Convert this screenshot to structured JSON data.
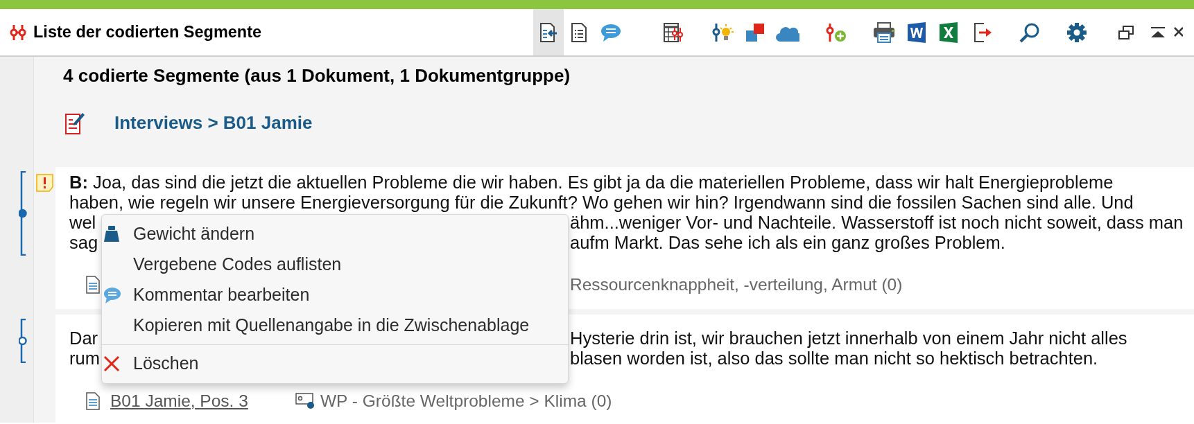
{
  "window": {
    "title": "Liste der codierten Segmente"
  },
  "toolbar": [
    {
      "selected": true
    },
    {
      "selected": false
    },
    {
      "selected": false
    },
    {
      "selected": false
    },
    {
      "selected": false
    },
    {
      "selected": false
    },
    {
      "selected": false
    },
    {
      "selected": false
    },
    {
      "selected": false
    },
    {
      "selected": false
    },
    {
      "selected": false
    },
    {
      "selected": false
    },
    {
      "selected": false
    },
    {
      "selected": false
    },
    {
      "selected": false
    },
    {
      "selected": false
    },
    {
      "selected": false
    }
  ],
  "summary": "4 codierte Segmente (aus 1 Dokument, 1 Dokumentgruppe)",
  "document_path": "Interviews > B01 Jamie",
  "segments": [
    {
      "marker_filled": true,
      "has_comment": true,
      "lines": [
        {
          "text": "**B:** Joa, das sind die jetzt die aktuellen Probleme die wir haben. Es gibt ja da die materiellen Probleme, dass wir halt Energieprobleme"
        },
        {
          "text": "haben, wie regeln wir unsere Energieversorgung für die Zukunft? Wo gehen wir hin? Irgendwann sind die fossilen Sachen sind alle. Und"
        },
        {
          "left": "wel",
          "right": "ähm...weniger Vor- und Nachteile. Wasserstoff ist noch nicht soweit, dass man"
        },
        {
          "left": "sag",
          "right": "aufm Markt. Das sehe ich als ein ganz großes Problem."
        }
      ],
      "code": "Ressourcenknappheit, -verteilung, Armut (0)"
    },
    {
      "marker_filled": false,
      "has_comment": false,
      "lines": [
        {
          "left": "Dar",
          "right": "Hysterie drin ist, wir brauchen jetzt innerhalb von einem Jahr nicht alles"
        },
        {
          "left": "rum",
          "right": "blasen worden ist, also das sollte man nicht so hektisch betrachten."
        }
      ],
      "source": "B01 Jamie, Pos. 3",
      "code": "WP - Größte Weltprobleme > Klima (0)"
    }
  ],
  "context_menu": [
    {
      "kind": "item",
      "label": "Gewicht ändern"
    },
    {
      "kind": "item",
      "label": "Vergebene Codes auflisten"
    },
    {
      "kind": "item",
      "label": "Kommentar bearbeiten"
    },
    {
      "kind": "item",
      "label": "Kopieren mit Quellenangabe in die Zwischenablage"
    },
    {
      "kind": "separator"
    },
    {
      "kind": "item",
      "label": "Löschen"
    }
  ]
}
